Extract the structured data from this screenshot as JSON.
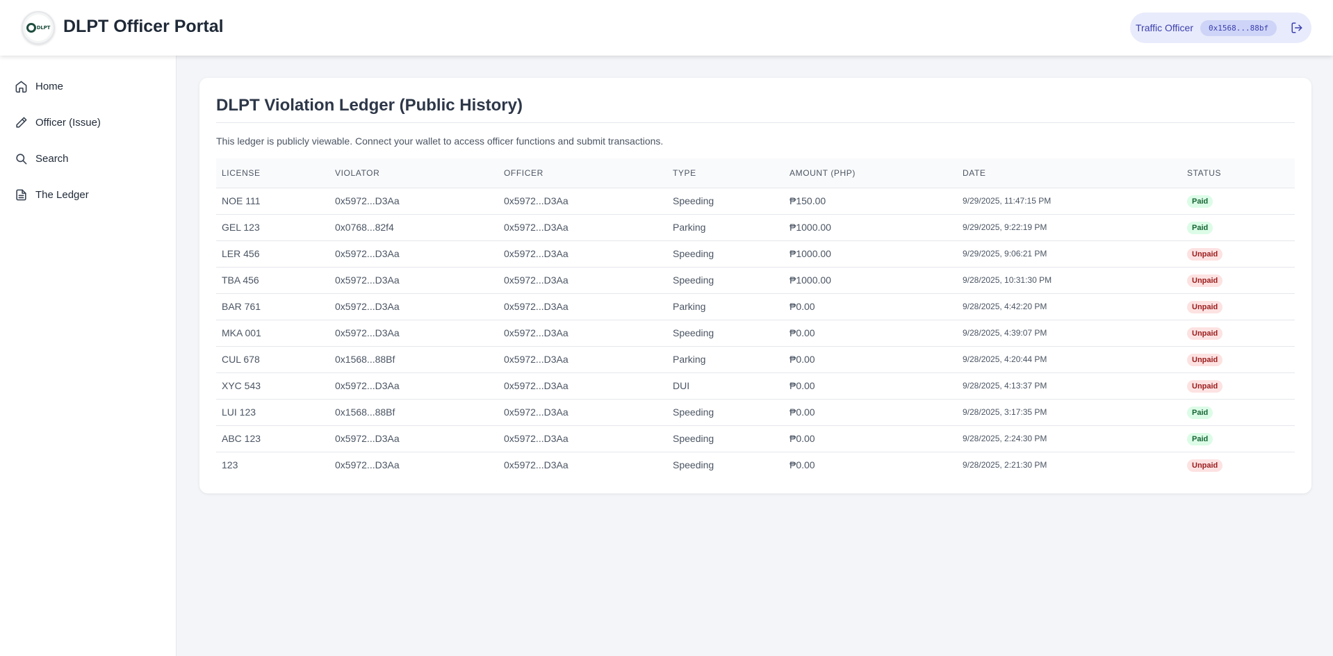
{
  "header": {
    "app_title": "DLPT Officer Portal",
    "logo_text": "DLPT",
    "role_label": "Traffic Officer",
    "wallet_address": "0x1568...88bf"
  },
  "sidebar": {
    "items": [
      {
        "label": "Home",
        "icon": "home-icon"
      },
      {
        "label": "Officer (Issue)",
        "icon": "pencil-icon"
      },
      {
        "label": "Search",
        "icon": "search-icon"
      },
      {
        "label": "The Ledger",
        "icon": "document-icon"
      }
    ]
  },
  "main": {
    "title": "DLPT Violation Ledger (Public History)",
    "description": "This ledger is publicly viewable. Connect your wallet to access officer functions and submit transactions.",
    "columns": [
      "LICENSE",
      "VIOLATOR",
      "OFFICER",
      "TYPE",
      "AMOUNT (PHP)",
      "DATE",
      "STATUS"
    ],
    "rows": [
      {
        "license": "NOE 111",
        "violator": "0x5972...D3Aa",
        "officer": "0x5972...D3Aa",
        "type": "Speeding",
        "amount": "₱150.00",
        "date": "9/29/2025, 11:47:15 PM",
        "status": "Paid"
      },
      {
        "license": "GEL 123",
        "violator": "0x0768...82f4",
        "officer": "0x5972...D3Aa",
        "type": "Parking",
        "amount": "₱1000.00",
        "date": "9/29/2025, 9:22:19 PM",
        "status": "Paid"
      },
      {
        "license": "LER 456",
        "violator": "0x5972...D3Aa",
        "officer": "0x5972...D3Aa",
        "type": "Speeding",
        "amount": "₱1000.00",
        "date": "9/29/2025, 9:06:21 PM",
        "status": "Unpaid"
      },
      {
        "license": "TBA 456",
        "violator": "0x5972...D3Aa",
        "officer": "0x5972...D3Aa",
        "type": "Speeding",
        "amount": "₱1000.00",
        "date": "9/28/2025, 10:31:30 PM",
        "status": "Unpaid"
      },
      {
        "license": "BAR 761",
        "violator": "0x5972...D3Aa",
        "officer": "0x5972...D3Aa",
        "type": "Parking",
        "amount": "₱0.00",
        "date": "9/28/2025, 4:42:20 PM",
        "status": "Unpaid"
      },
      {
        "license": "MKA 001",
        "violator": "0x5972...D3Aa",
        "officer": "0x5972...D3Aa",
        "type": "Speeding",
        "amount": "₱0.00",
        "date": "9/28/2025, 4:39:07 PM",
        "status": "Unpaid"
      },
      {
        "license": "CUL 678",
        "violator": "0x1568...88Bf",
        "officer": "0x5972...D3Aa",
        "type": "Parking",
        "amount": "₱0.00",
        "date": "9/28/2025, 4:20:44 PM",
        "status": "Unpaid"
      },
      {
        "license": "XYC 543",
        "violator": "0x5972...D3Aa",
        "officer": "0x5972...D3Aa",
        "type": "DUI",
        "amount": "₱0.00",
        "date": "9/28/2025, 4:13:37 PM",
        "status": "Unpaid"
      },
      {
        "license": "LUI 123",
        "violator": "0x1568...88Bf",
        "officer": "0x5972...D3Aa",
        "type": "Speeding",
        "amount": "₱0.00",
        "date": "9/28/2025, 3:17:35 PM",
        "status": "Paid"
      },
      {
        "license": "ABC 123",
        "violator": "0x5972...D3Aa",
        "officer": "0x5972...D3Aa",
        "type": "Speeding",
        "amount": "₱0.00",
        "date": "9/28/2025, 2:24:30 PM",
        "status": "Paid"
      },
      {
        "license": "123",
        "violator": "0x5972...D3Aa",
        "officer": "0x5972...D3Aa",
        "type": "Speeding",
        "amount": "₱0.00",
        "date": "9/28/2025, 2:21:30 PM",
        "status": "Unpaid"
      }
    ]
  },
  "colors": {
    "paid_bg": "#dcfce7",
    "paid_text": "#166534",
    "unpaid_bg": "#fde2e2",
    "unpaid_text": "#991b1b",
    "accent": "#3b3fae"
  }
}
